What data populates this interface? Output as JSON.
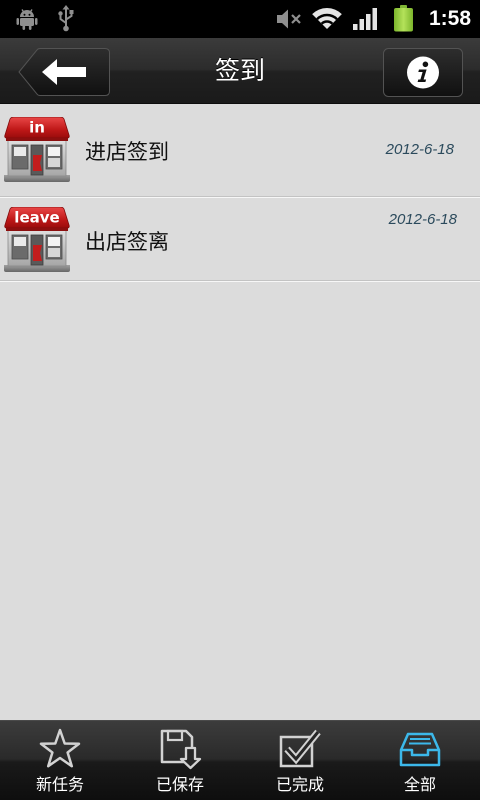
{
  "status_bar": {
    "time": "1:58",
    "left_icons": [
      "android-icon",
      "usb-icon"
    ],
    "right_icons": [
      "mute-icon",
      "wifi-icon",
      "signal-icon",
      "battery-icon"
    ]
  },
  "header": {
    "title": "签到",
    "back_icon": "back-arrow-icon",
    "info_icon": "info-icon"
  },
  "list": {
    "items": [
      {
        "icon": "store-icon",
        "badge": "in",
        "label": "进店签到",
        "date": "2012-6-18"
      },
      {
        "icon": "store-icon",
        "badge": "leave",
        "label": "出店签离",
        "date": "2012-6-18"
      }
    ]
  },
  "tabs": [
    {
      "label": "新任务",
      "icon": "star-icon",
      "active": false
    },
    {
      "label": "已保存",
      "icon": "save-icon",
      "active": false
    },
    {
      "label": "已完成",
      "icon": "check-icon",
      "active": false
    },
    {
      "label": "全部",
      "icon": "inbox-icon",
      "active": true
    }
  ],
  "colors": {
    "accent": "#3cb8ea",
    "battery": "#8cc63f",
    "date_text": "#2b4a5c",
    "store_awning": "#c41b1b"
  }
}
